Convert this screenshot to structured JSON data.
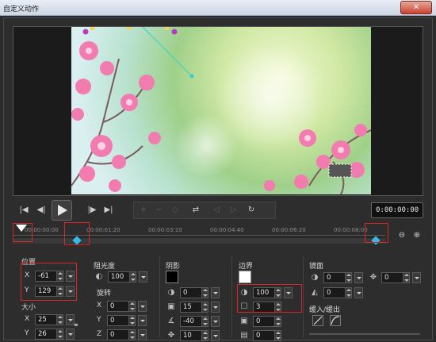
{
  "window": {
    "title": "自定义动作",
    "close_label": "✕"
  },
  "timecode": "0:00:00:00",
  "timeline": {
    "ticks": [
      "00:00:00:00",
      "00:00:01:20",
      "00:00:03:10",
      "00:00:04:40",
      "00:00:06:20",
      "00:00:08:00"
    ]
  },
  "position": {
    "label": "位置",
    "x_label": "X",
    "x": "-61",
    "y_label": "Y",
    "y": "129"
  },
  "size": {
    "label": "大小",
    "x_label": "X",
    "x": "25",
    "y_label": "Y",
    "y": "26"
  },
  "opacity": {
    "label": "阻光度",
    "value": "100"
  },
  "rotation": {
    "label": "旋转",
    "x_label": "X",
    "x": "0",
    "y_label": "Y",
    "y": "0",
    "z_label": "Z",
    "z": "0"
  },
  "shadow": {
    "label": "阴影",
    "color": "#000000",
    "v1": "0",
    "v2": "15",
    "v3": "-40",
    "v4": "10"
  },
  "border": {
    "label": "边界",
    "color": "#ffffff",
    "opacity": "100",
    "width": "3",
    "v3": "0",
    "v4": "0"
  },
  "mirror": {
    "label": "镜面",
    "v1": "0",
    "v2": "0",
    "move": "0"
  },
  "ease": {
    "label": "缓入/缓出"
  },
  "colors": {
    "keyframe": "#35b9e8",
    "highlight": "#d9262b",
    "path": "#31d2c8",
    "handle": "#b23fb8"
  }
}
